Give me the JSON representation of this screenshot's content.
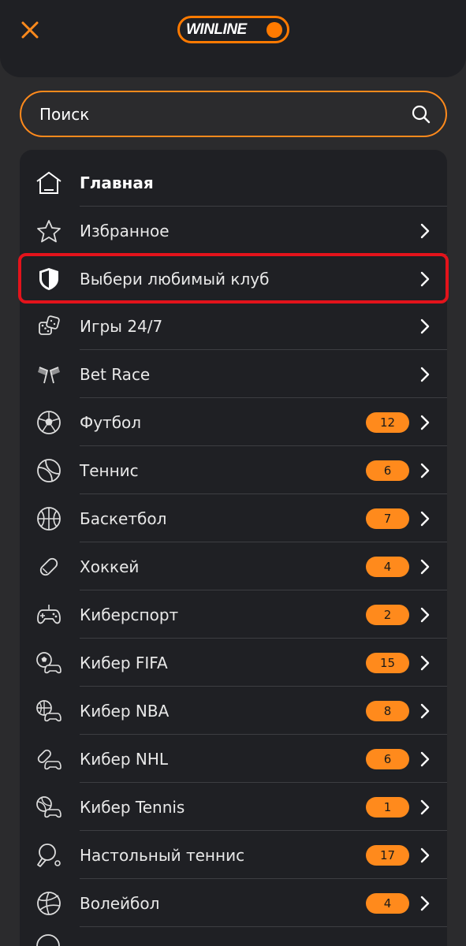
{
  "header": {
    "logo_text": "WINLINE",
    "accent_color": "#ff7a00"
  },
  "search": {
    "placeholder": "Поиск"
  },
  "menu": {
    "items": [
      {
        "label": "Главная",
        "icon": "home-icon"
      },
      {
        "label": "Избранное",
        "icon": "star-icon"
      },
      {
        "label": "Выбери любимый клуб",
        "icon": "shield-icon"
      },
      {
        "label": "Игры 24/7",
        "icon": "dice-icon"
      },
      {
        "label": "Bet Race",
        "icon": "race-flags-icon"
      },
      {
        "label": "Футбол",
        "icon": "football-icon",
        "count": "12"
      },
      {
        "label": "Теннис",
        "icon": "tennis-icon",
        "count": "6"
      },
      {
        "label": "Баскетбол",
        "icon": "basketball-icon",
        "count": "7"
      },
      {
        "label": "Хоккей",
        "icon": "hockey-icon",
        "count": "4"
      },
      {
        "label": "Киберспорт",
        "icon": "gamepad-icon",
        "count": "2"
      },
      {
        "label": "Кибер FIFA",
        "icon": "cyber-football-icon",
        "count": "15"
      },
      {
        "label": "Кибер NBA",
        "icon": "cyber-basketball-icon",
        "count": "8"
      },
      {
        "label": "Кибер NHL",
        "icon": "cyber-hockey-icon",
        "count": "6"
      },
      {
        "label": "Кибер Tennis",
        "icon": "cyber-tennis-icon",
        "count": "1"
      },
      {
        "label": "Настольный теннис",
        "icon": "table-tennis-icon",
        "count": "17"
      },
      {
        "label": "Волейбол",
        "icon": "volleyball-icon",
        "count": "4"
      }
    ]
  }
}
